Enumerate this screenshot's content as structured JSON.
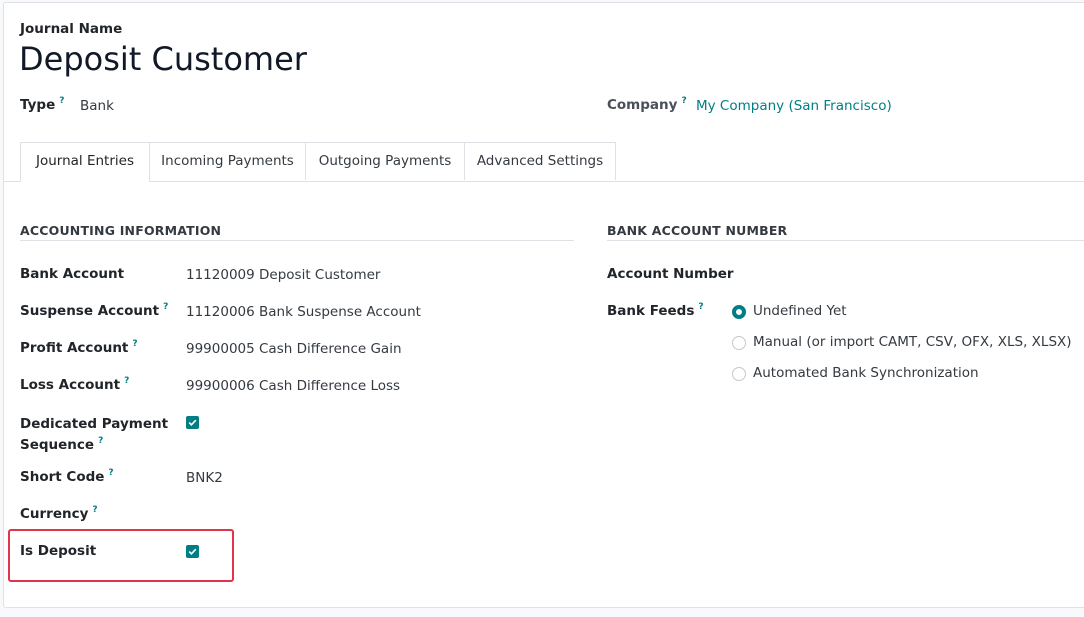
{
  "header": {
    "journal_name_label": "Journal Name",
    "journal_name": "Deposit Customer",
    "type_label": "Type",
    "type_value": "Bank",
    "company_label": "Company",
    "company_value": "My Company (San Francisco)",
    "help_mark": "?"
  },
  "tabs": [
    {
      "label": "Journal Entries",
      "active": true
    },
    {
      "label": "Incoming Payments",
      "active": false
    },
    {
      "label": "Outgoing Payments",
      "active": false
    },
    {
      "label": "Advanced Settings",
      "active": false
    }
  ],
  "accounting": {
    "title": "ACCOUNTING INFORMATION",
    "bank_account_label": "Bank Account",
    "bank_account_value": "11120009 Deposit Customer",
    "suspense_label": "Suspense Account",
    "suspense_value": "11120006 Bank Suspense Account",
    "profit_label": "Profit Account",
    "profit_value": "99900005 Cash Difference Gain",
    "loss_label": "Loss Account",
    "loss_value": "99900006 Cash Difference Loss",
    "dedicated_label_line1": "Dedicated Payment",
    "dedicated_label_line2": "Sequence",
    "dedicated_checked": true,
    "short_code_label": "Short Code",
    "short_code_value": "BNK2",
    "currency_label": "Currency",
    "is_deposit_label": "Is Deposit",
    "is_deposit_checked": true
  },
  "bank": {
    "title": "BANK ACCOUNT NUMBER",
    "account_number_label": "Account Number",
    "bank_feeds_label": "Bank Feeds",
    "options": [
      {
        "label": "Undefined Yet",
        "selected": true
      },
      {
        "label": "Manual (or import CAMT, CSV, OFX, XLS, XLSX)",
        "selected": false
      },
      {
        "label": "Automated Bank Synchronization",
        "selected": false
      }
    ]
  },
  "colors": {
    "accent": "#017e84",
    "highlight": "#e0344a"
  }
}
